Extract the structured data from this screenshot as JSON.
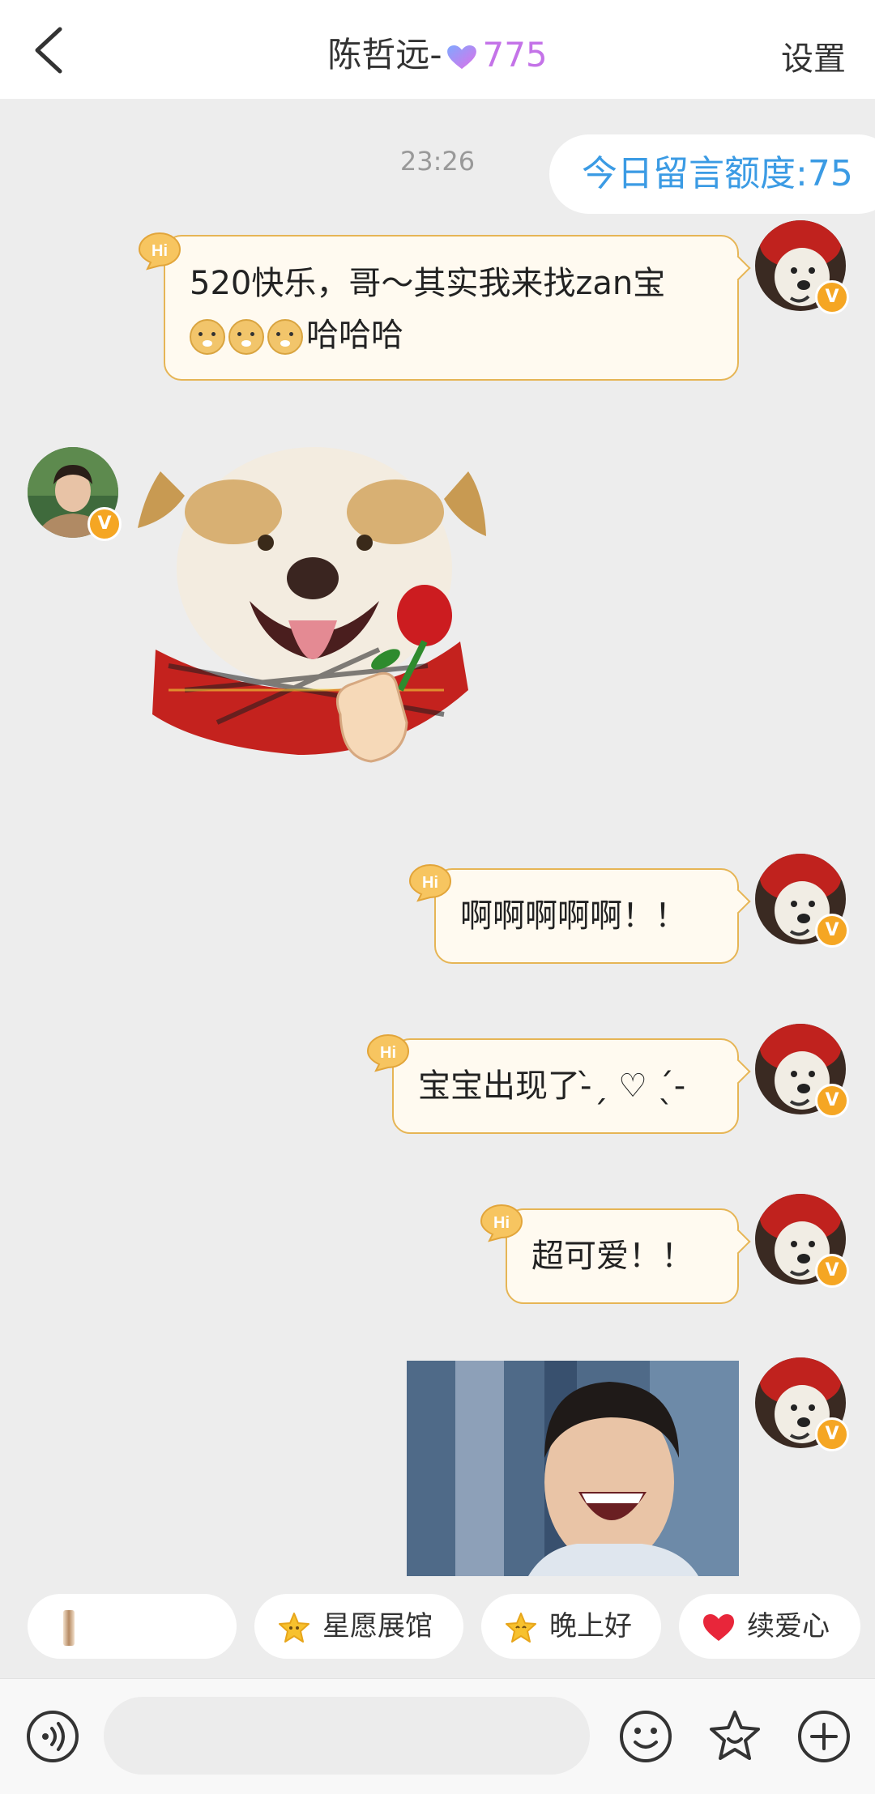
{
  "header": {
    "title_name": "陈哲远-",
    "title_score": "775",
    "settings_label": "设置"
  },
  "chat": {
    "timestamp": "23:26",
    "quota_label": "今日留言额度:75",
    "messages": [
      {
        "line1": "520快乐，哥～其实我来找zan宝",
        "line2": "哈哈哈"
      },
      {
        "text": "啊啊啊啊啊！！"
      },
      {
        "text": "宝宝出现了-̀ˏ ♡ ˎ́-"
      },
      {
        "text": "超可爱！！"
      }
    ],
    "badge_letter": "V",
    "hi_label": "Hi"
  },
  "quick_replies": [
    {
      "label": "",
      "icon": "image-thumb-icon"
    },
    {
      "label": "星愿展馆",
      "icon": "star-icon"
    },
    {
      "label": "晚上好",
      "icon": "star-face-icon"
    },
    {
      "label": "续爱心",
      "icon": "heart-icon"
    }
  ],
  "colors": {
    "accent_blue": "#3b9be4",
    "score_purple": "#c473e8",
    "bubble_border": "#e6b555",
    "badge_orange": "#f5a623"
  }
}
